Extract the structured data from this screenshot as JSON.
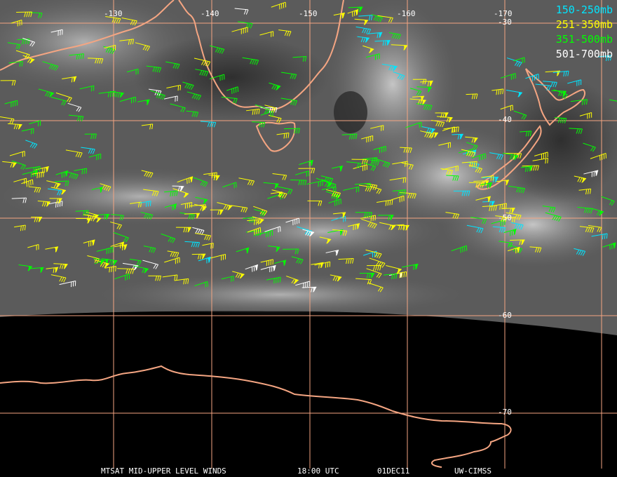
{
  "map": {
    "longitude_labels": [
      "-130",
      "-140",
      "-150",
      "-160",
      "-170"
    ],
    "latitude_labels": [
      "-30",
      "-40",
      "-50",
      "-60",
      "-70"
    ],
    "colors": {
      "gridline": "#f4a582",
      "coastline": "#f4a582",
      "night_area": "#000000",
      "label_text": "#ffffff"
    }
  },
  "legend": {
    "items": [
      {
        "label": "150-250mb",
        "color": "#00e5ff"
      },
      {
        "label": "251-350mb",
        "color": "#ffff00"
      },
      {
        "label": "351-500mb",
        "color": "#00ff00"
      },
      {
        "label": "501-700mb",
        "color": "#ffffff"
      }
    ]
  },
  "footer": {
    "product": "MTSAT MID-UPPER LEVEL WINDS",
    "time": "18:00 UTC",
    "date": "01DEC11",
    "source": "UW-CIMSS"
  },
  "wind_layers": [
    {
      "name": "150-250mb",
      "color_key": 0
    },
    {
      "name": "251-350mb",
      "color_key": 1
    },
    {
      "name": "351-500mb",
      "color_key": 2
    },
    {
      "name": "501-700mb",
      "color_key": 3
    }
  ]
}
